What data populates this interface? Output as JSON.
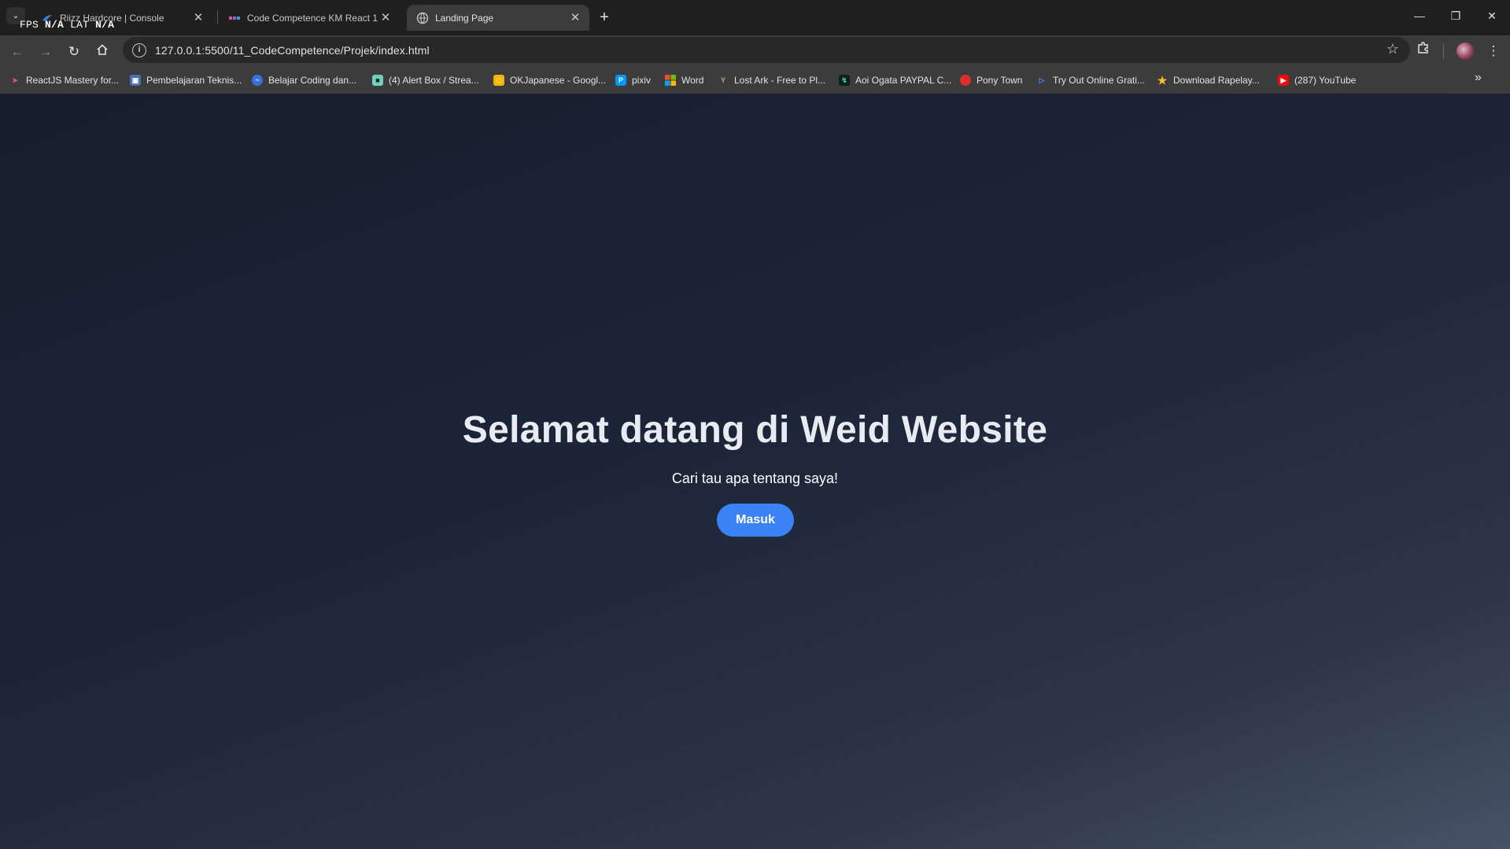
{
  "overlay": {
    "fps_label": "FPS",
    "fps_value": "N/A",
    "lat_label": "LAT",
    "lat_value": "N/A"
  },
  "tabs": [
    {
      "title": "Riizz Hardcore | Console",
      "active": false
    },
    {
      "title": "Code Competence KM React 1",
      "active": false
    },
    {
      "title": "Landing Page",
      "active": true
    }
  ],
  "address_bar": {
    "url": "127.0.0.1:5500/11_CodeCompetence/Projek/index.html"
  },
  "bookmarks": [
    {
      "label": "ReactJS Mastery for...",
      "icon": "arrow-icon"
    },
    {
      "label": "Pembelajaran Teknis...",
      "icon": "laptop-icon"
    },
    {
      "label": "Belajar Coding dan...",
      "icon": "dicoding-icon"
    },
    {
      "label": "(4) Alert Box / Strea...",
      "icon": "streamlabs-icon"
    },
    {
      "label": "OKJapanese - Googl...",
      "icon": "slides-icon"
    },
    {
      "label": "pixiv",
      "icon": "pixiv-icon"
    },
    {
      "label": "Word",
      "icon": "microsoft-icon"
    },
    {
      "label": "Lost Ark - Free to Pl...",
      "icon": "lost-ark-icon"
    },
    {
      "label": "Aoi Ogata PAYPAL C...",
      "icon": "lightning-icon"
    },
    {
      "label": "Pony Town",
      "icon": "apple-icon"
    },
    {
      "label": "Try Out Online Grati...",
      "icon": "play-outline-icon"
    },
    {
      "label": "Download Rapelay...",
      "icon": "star-icon"
    },
    {
      "label": "(287) YouTube",
      "icon": "youtube-icon"
    }
  ],
  "hero": {
    "title": "Selamat datang di Weid Website",
    "subtitle": "Cari tau apa tentang saya!",
    "button_label": "Masuk"
  },
  "colors": {
    "accent_button": "#3b82f6",
    "page_gradient_start": "#161d2c",
    "page_gradient_end": "#475266",
    "chrome_dark": "#1f1f1f",
    "chrome_toolbar": "#3c3c3c"
  }
}
